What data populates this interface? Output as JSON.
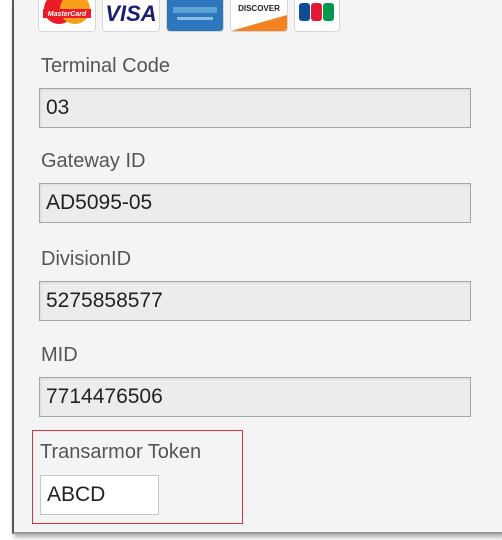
{
  "card_logos": [
    {
      "name": "MasterCard",
      "icon": "mastercard-icon"
    },
    {
      "name": "VISA",
      "icon": "visa-icon"
    },
    {
      "name": "American Express",
      "icon": "amex-icon"
    },
    {
      "name": "DISCOVER",
      "icon": "discover-icon"
    },
    {
      "name": "JCB",
      "icon": "jcb-icon"
    }
  ],
  "fields": {
    "terminal_code": {
      "label": "Terminal Code",
      "value": "03"
    },
    "gateway_id": {
      "label": "Gateway ID",
      "value": "AD5095-05"
    },
    "division_id": {
      "label": "DivisionID",
      "value": "5275858577"
    },
    "mid": {
      "label": "MID",
      "value": "7714476506"
    },
    "transarmor_token": {
      "label": "Transarmor Token",
      "value": "ABCD"
    }
  },
  "colors": {
    "highlight_border": "#d9333f",
    "panel_background": "#f4f4f4",
    "readonly_field_background": "#ececec"
  }
}
